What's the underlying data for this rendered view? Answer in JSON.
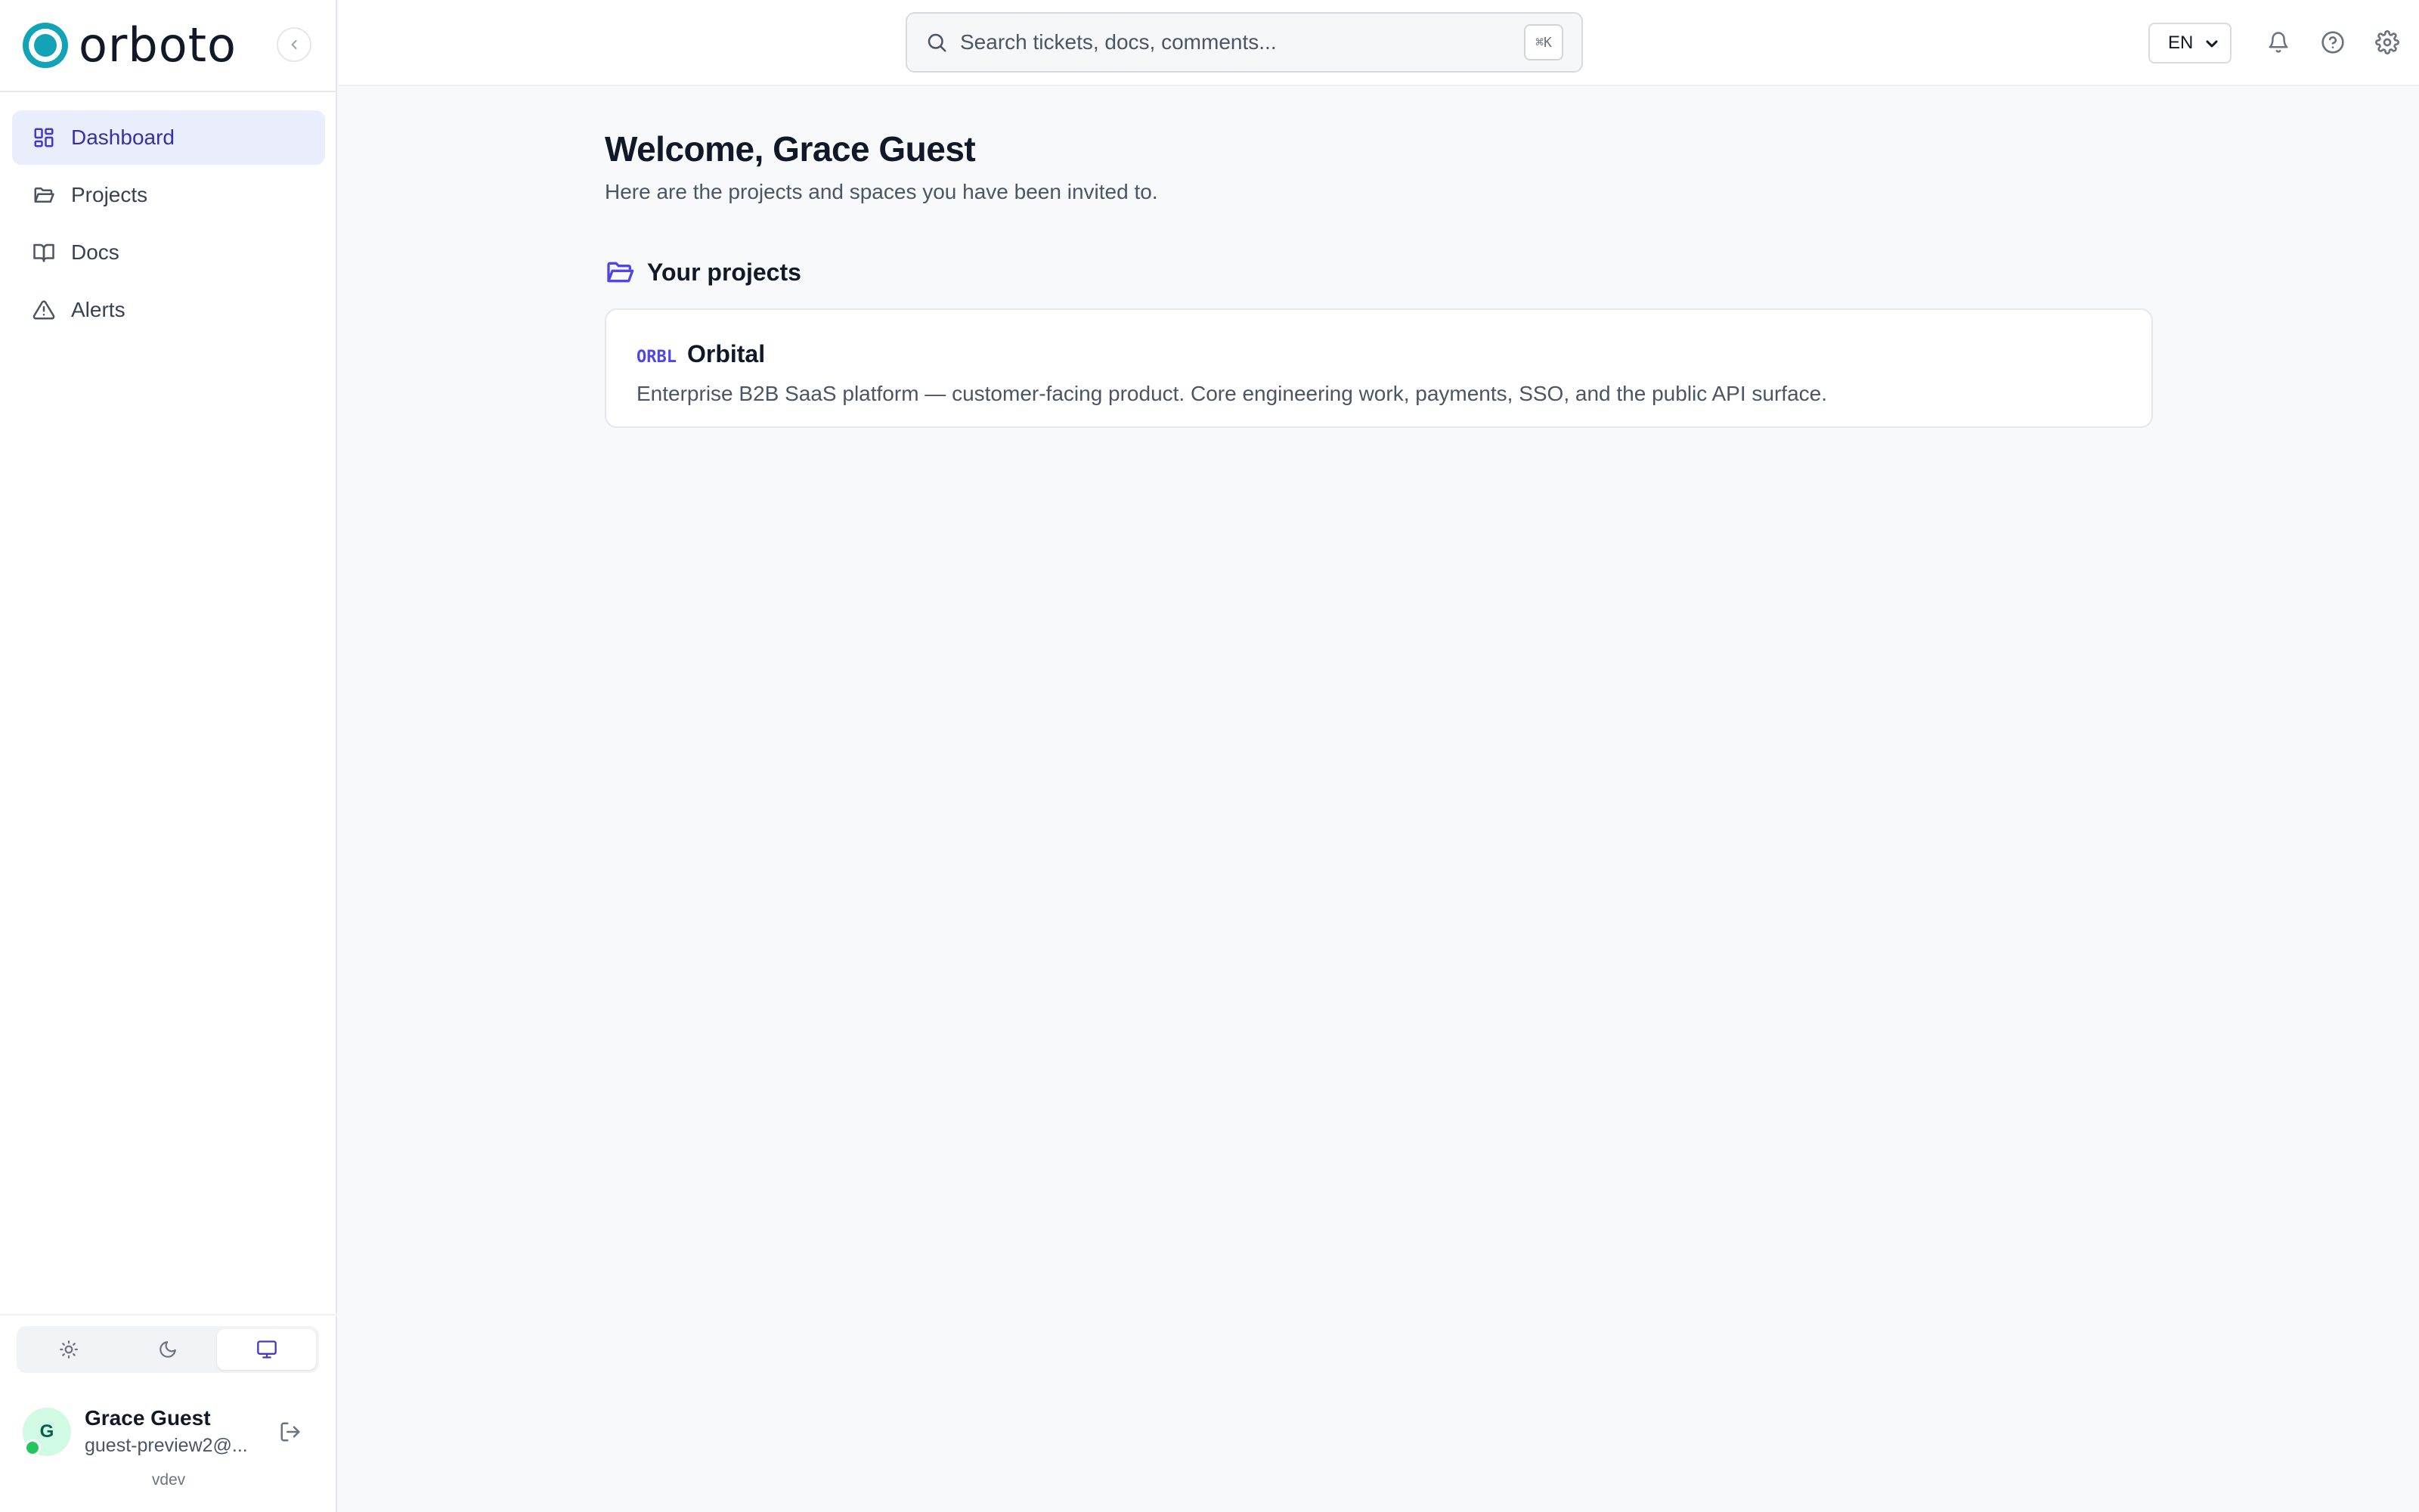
{
  "brand": {
    "name": "orboto",
    "color": "#13a3b6"
  },
  "sidebar": {
    "items": [
      {
        "label": "Dashboard",
        "icon": "dashboard-grid-icon",
        "active": true
      },
      {
        "label": "Projects",
        "icon": "folder-open-icon",
        "active": false
      },
      {
        "label": "Docs",
        "icon": "book-open-icon",
        "active": false
      },
      {
        "label": "Alerts",
        "icon": "alert-triangle-icon",
        "active": false
      }
    ],
    "theme": {
      "options": [
        "light",
        "dark",
        "system"
      ],
      "selected": "system"
    },
    "user": {
      "initial": "G",
      "name": "Grace Guest",
      "email": "guest-preview2@...",
      "status": "online"
    },
    "version": "vdev"
  },
  "topbar": {
    "search": {
      "placeholder": "Search tickets, docs, comments...",
      "shortcut": "⌘K"
    },
    "language": "EN"
  },
  "main": {
    "title": "Welcome, Grace Guest",
    "subtitle": "Here are the projects and spaces you have been invited to.",
    "projects_section": {
      "title": "Your projects",
      "projects": [
        {
          "key": "ORBL",
          "name": "Orbital",
          "description": "Enterprise B2B SaaS platform — customer-facing product. Core engineering work, payments, SSO, and the public API surface."
        }
      ]
    }
  },
  "colors": {
    "accent": "#4f46e5",
    "active_bg": "#eaeefc",
    "online": "#22c55e"
  }
}
